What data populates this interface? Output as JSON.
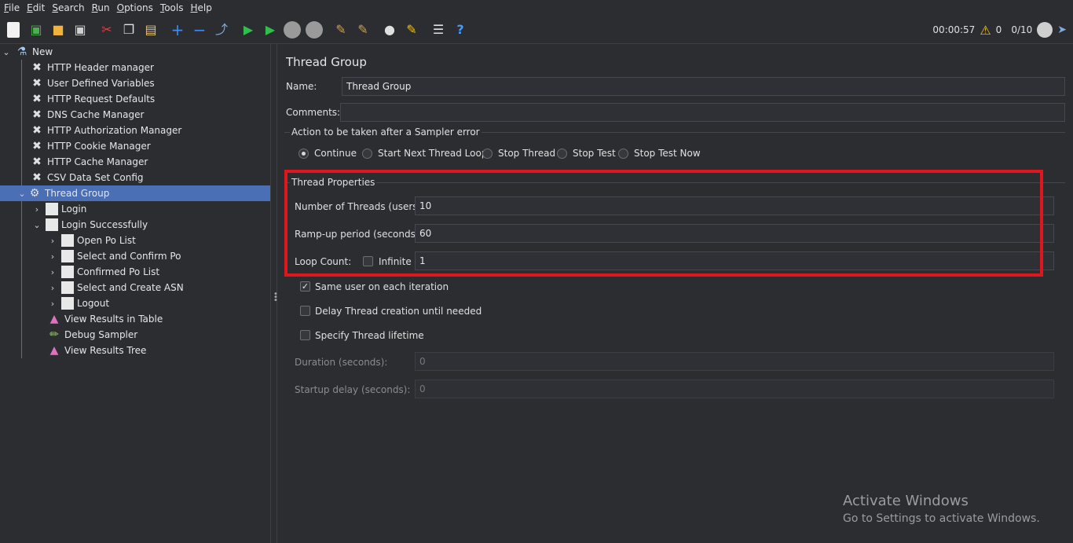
{
  "menu": [
    {
      "u": "F",
      "rest": "ile"
    },
    {
      "u": "E",
      "rest": "dit"
    },
    {
      "u": "S",
      "rest": "earch"
    },
    {
      "u": "R",
      "rest": "un"
    },
    {
      "u": "O",
      "rest": "ptions"
    },
    {
      "u": "T",
      "rest": "ools"
    },
    {
      "u": "H",
      "rest": "elp"
    }
  ],
  "toolbar": {
    "timer": "00:00:57",
    "warnings": "0",
    "threads": "0/10"
  },
  "tree": {
    "root": "New",
    "config": [
      "HTTP Header manager",
      "User Defined Variables",
      "HTTP Request Defaults",
      "DNS Cache Manager",
      "HTTP Authorization Manager",
      "HTTP Cookie Manager",
      "HTTP Cache Manager",
      "CSV Data Set Config"
    ],
    "thread_group": "Thread Group",
    "login": "Login",
    "login_success": "Login Successfully",
    "sub": [
      "Open Po List",
      "Select and Confirm Po",
      "Confirmed Po List",
      "Select and Create ASN",
      "Logout"
    ],
    "listeners": [
      "View Results in Table",
      "Debug Sampler",
      "View Results Tree"
    ]
  },
  "panel": {
    "title": "Thread Group",
    "name_label": "Name:",
    "name_value": "Thread Group",
    "comments_label": "Comments:",
    "comments_value": "",
    "action_group": "Action to be taken after a Sampler error",
    "actions": [
      "Continue",
      "Start Next Thread Loop",
      "Stop Thread",
      "Stop Test",
      "Stop Test Now"
    ],
    "props_group": "Thread Properties",
    "threads_label": "Number of Threads (users):",
    "threads_value": "10",
    "rampup_label": "Ramp-up period (seconds):",
    "rampup_value": "60",
    "loop_label": "Loop Count:",
    "infinite_label": "Infinite",
    "loop_value": "1",
    "same_user": "Same user on each iteration",
    "delay_creation": "Delay Thread creation until needed",
    "specify_lifetime": "Specify Thread lifetime",
    "duration_label": "Duration (seconds):",
    "duration_value": "0",
    "startup_label": "Startup delay (seconds):",
    "startup_value": "0"
  },
  "watermark": {
    "line1": "Activate Windows",
    "line2": "Go to Settings to activate Windows."
  }
}
